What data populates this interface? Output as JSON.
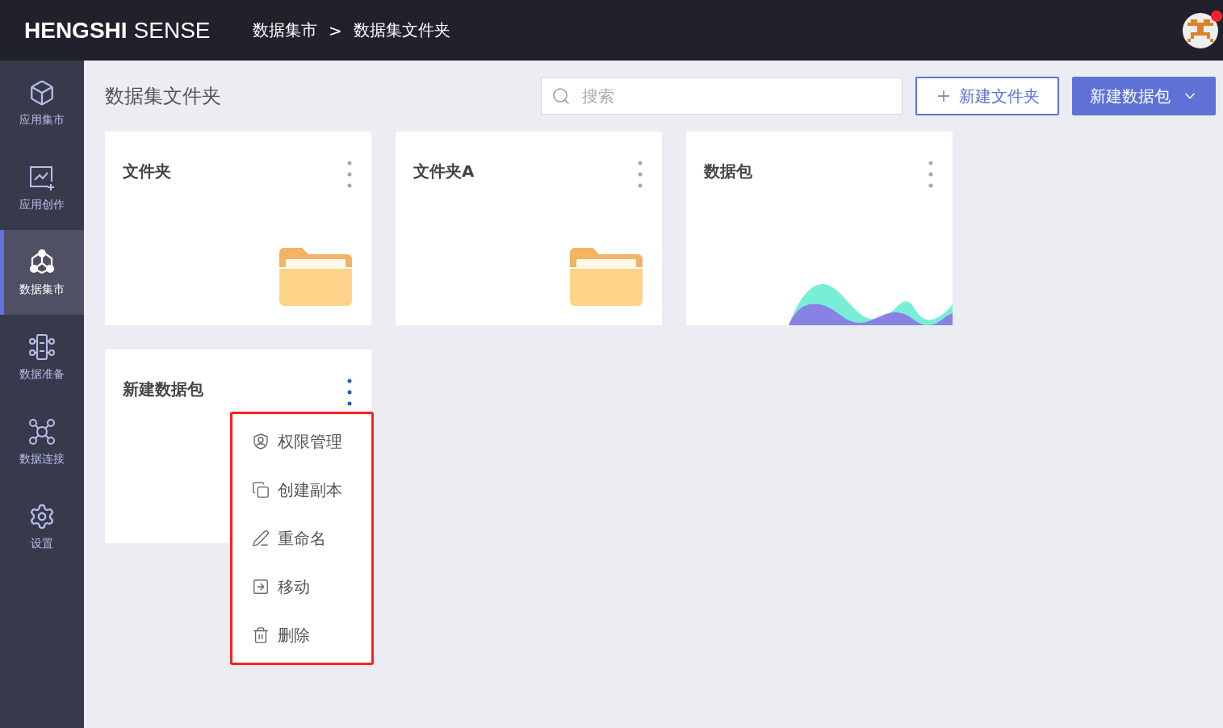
{
  "header": {
    "brand_bold": "HENGSHI",
    "brand_light": "SENSE",
    "breadcrumb": [
      "数据集市",
      "数据集文件夹"
    ],
    "separator": ">",
    "notification": true
  },
  "sidebar": {
    "items": [
      {
        "label": "应用集市",
        "kind": "cube",
        "selected": false
      },
      {
        "label": "应用创作",
        "kind": "chart",
        "selected": false
      },
      {
        "label": "数据集市",
        "kind": "market",
        "selected": true
      },
      {
        "label": "数据准备",
        "kind": "prep",
        "selected": false
      },
      {
        "label": "数据连接",
        "kind": "connect",
        "selected": false
      },
      {
        "label": "设置",
        "kind": "settings",
        "selected": false
      }
    ]
  },
  "page": {
    "title": "数据集文件夹",
    "search": {
      "placeholder": "搜索"
    },
    "new_folder": "新建文件夹",
    "new_package": "新建数据包"
  },
  "cards": [
    {
      "title": "文件夹",
      "kind": "folder",
      "menu_open": false
    },
    {
      "title": "文件夹A",
      "kind": "folder",
      "menu_open": false
    },
    {
      "title": "数据包",
      "kind": "dataset",
      "menu_open": false
    },
    {
      "title": "新建数据包",
      "kind": "empty",
      "menu_open": true
    }
  ],
  "menu": {
    "items": [
      {
        "label": "权限管理",
        "kind": "permission"
      },
      {
        "label": "创建副本",
        "kind": "copy"
      },
      {
        "label": "重命名",
        "kind": "rename"
      },
      {
        "label": "移动",
        "kind": "move"
      },
      {
        "label": "删除",
        "kind": "delete"
      }
    ]
  }
}
